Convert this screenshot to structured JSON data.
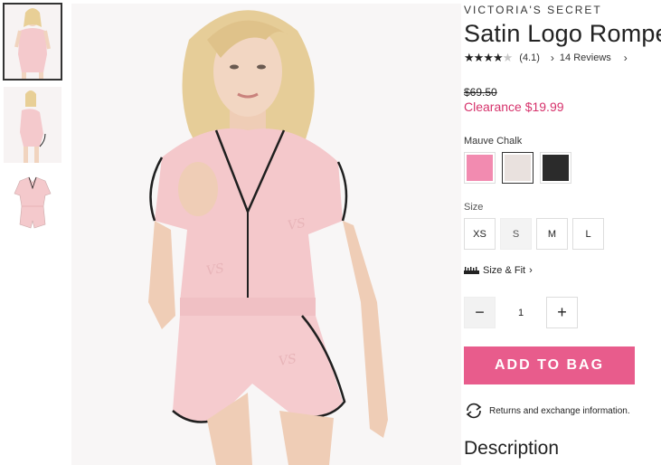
{
  "product": {
    "brand": "VICTORIA'S SECRET",
    "title": "Satin Logo Romper",
    "rating_value": 4,
    "rating_max": 5,
    "rating_text": "(4.1)",
    "reviews_link": "14 Reviews",
    "original_price": "$69.50",
    "sale_price": "Clearance $19.99"
  },
  "color": {
    "selected_label": "Mauve Chalk",
    "swatches": [
      {
        "name": "pink",
        "hex": "#f28bb0"
      },
      {
        "name": "mauve-chalk",
        "hex": "#e9e1de"
      },
      {
        "name": "black",
        "hex": "#2b2b2b"
      }
    ],
    "selected_index": 1
  },
  "size": {
    "label": "Size",
    "options": [
      "XS",
      "S",
      "M",
      "L"
    ],
    "unavailable": [
      "S"
    ]
  },
  "size_fit": {
    "label": "Size & Fit"
  },
  "quantity": {
    "minus": "−",
    "value": "1",
    "plus": "+"
  },
  "actions": {
    "add_to_bag": "ADD TO BAG",
    "returns_text": "Returns and exchange information."
  },
  "sections": {
    "description_heading": "Description"
  },
  "icons": {
    "star": "star-icon",
    "chevron": "chevron-right-icon",
    "ruler": "ruler-icon",
    "returns": "returns-icon"
  },
  "colors": {
    "accent_pink": "#d6336c",
    "button_pink": "#e85c8c",
    "romper_pink": "#f4c9cc"
  }
}
